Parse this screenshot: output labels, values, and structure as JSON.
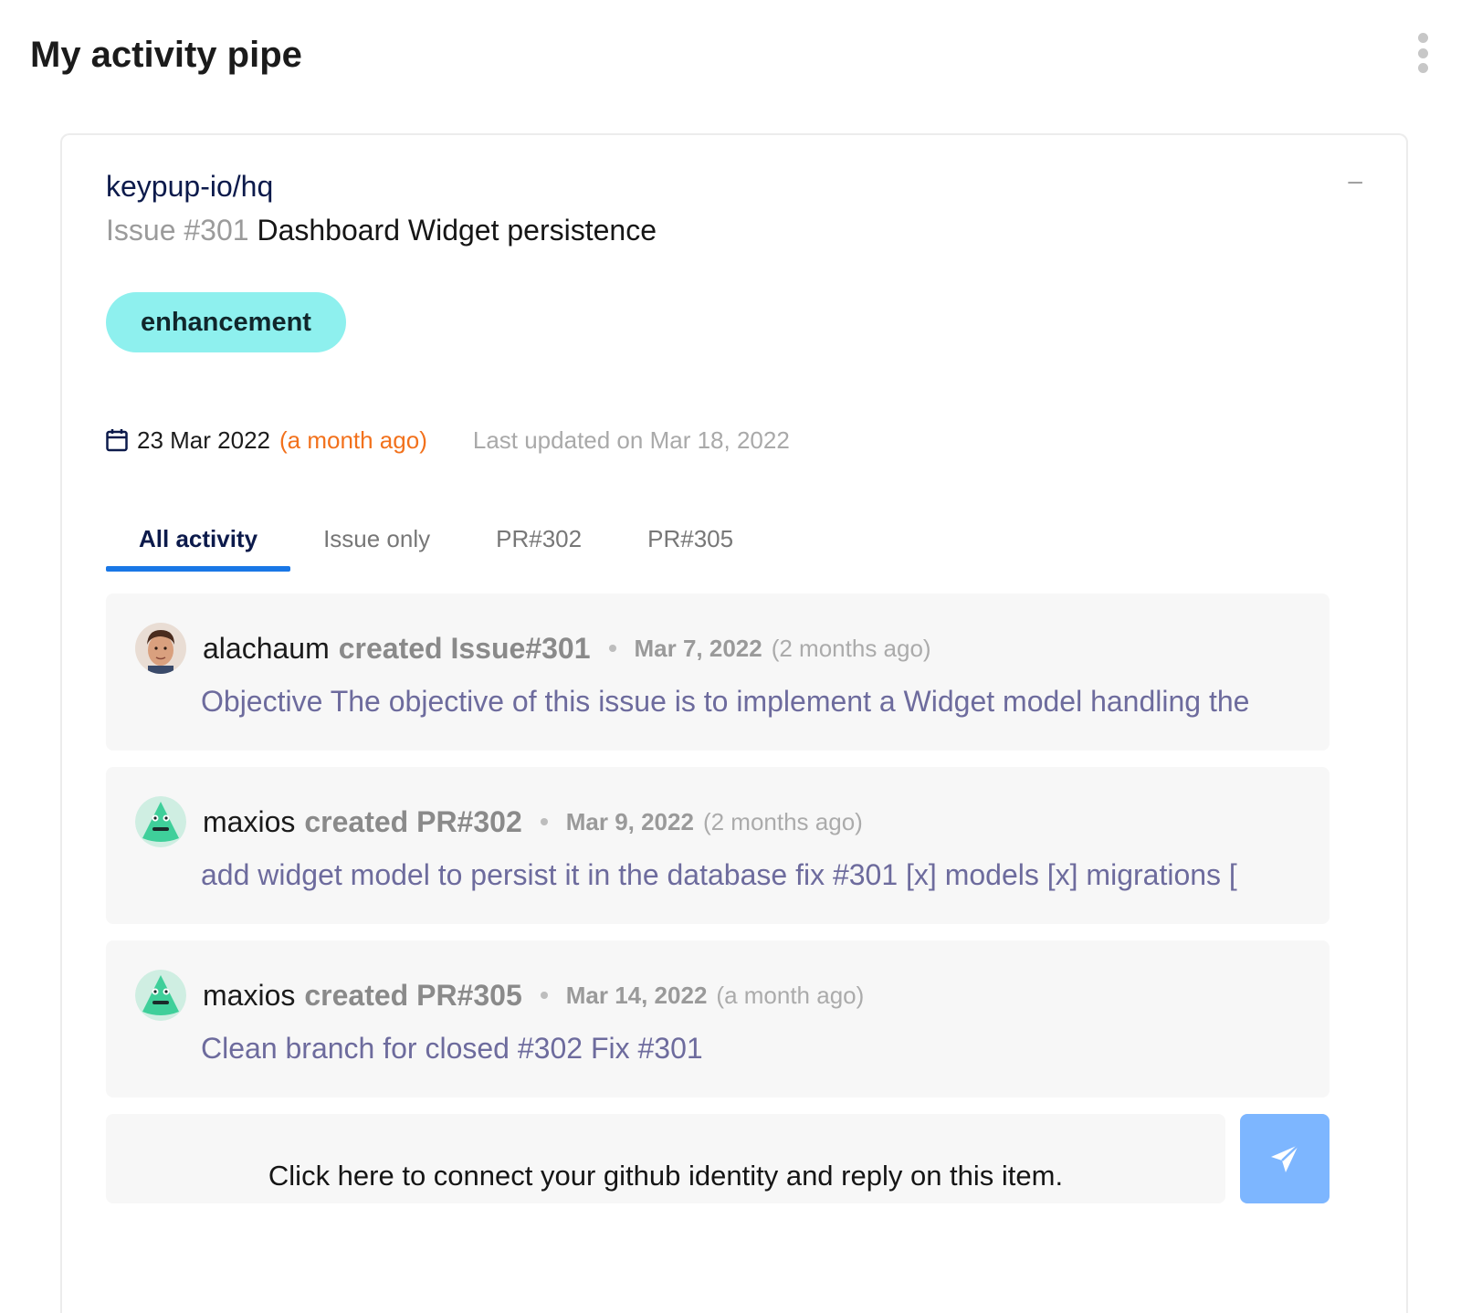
{
  "page": {
    "title": "My activity pipe"
  },
  "card": {
    "repo": "keypup-io/hq",
    "collapse_label": "–",
    "issue_number": "Issue #301",
    "issue_title": "Dashboard Widget persistence",
    "label": "enhancement",
    "created_date": "23 Mar 2022",
    "created_relative": "(a month ago)",
    "last_updated": "Last updated on Mar 18, 2022"
  },
  "tabs": [
    {
      "label": "All activity",
      "active": true
    },
    {
      "label": "Issue only",
      "active": false
    },
    {
      "label": "PR#302",
      "active": false
    },
    {
      "label": "PR#305",
      "active": false
    }
  ],
  "activities": [
    {
      "user": "alachaum",
      "action": "created Issue#301",
      "date": "Mar 7, 2022",
      "relative": "(2 months ago)",
      "body": "Objective The objective of this issue is to implement a Widget model handling the",
      "avatar": "person-avatar"
    },
    {
      "user": "maxios",
      "action": "created PR#302",
      "date": "Mar 9, 2022",
      "relative": "(2 months ago)",
      "body": "add widget model to persist it in the database fix #301 [x] models [x] migrations [",
      "avatar": "robot-avatar"
    },
    {
      "user": "maxios",
      "action": "created PR#305",
      "date": "Mar 14, 2022",
      "relative": "(a month ago)",
      "body": "Clean branch for closed #302 Fix #301",
      "avatar": "robot-avatar"
    }
  ],
  "reply": {
    "prompt": "Click here to connect your github identity and reply on this item.",
    "send_icon": "paper-plane-icon"
  },
  "colors": {
    "label_bg": "#8ef0ee",
    "tab_active": "#1977e6",
    "relative_date": "#f2711c",
    "send_button": "#7db6ff",
    "activity_body": "#6d6b9d"
  }
}
